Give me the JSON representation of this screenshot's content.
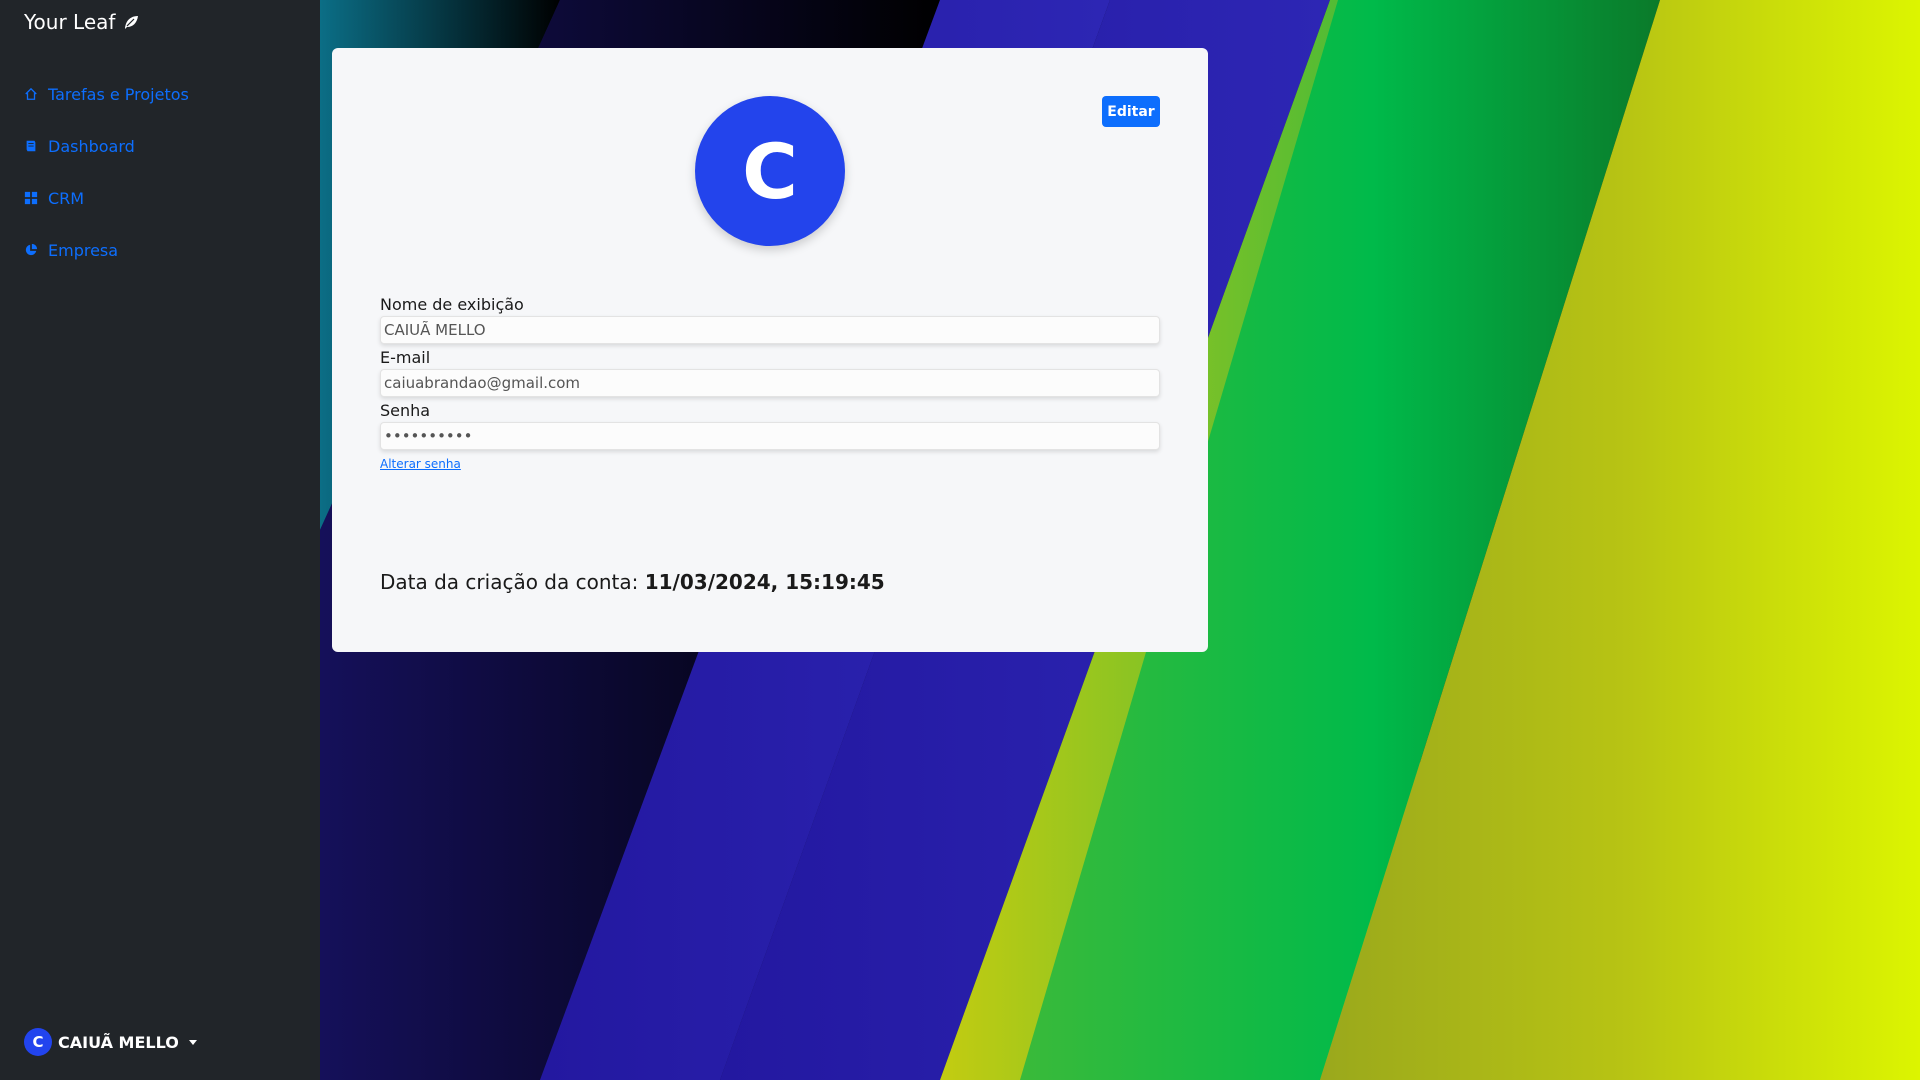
{
  "sidebar": {
    "brand": "Your Leaf",
    "brand_icon": "leaf-icon",
    "items": [
      {
        "label": "Tarefas e Projetos",
        "icon": "house-icon"
      },
      {
        "label": "Dashboard",
        "icon": "book-icon"
      },
      {
        "label": "CRM",
        "icon": "grid-icon"
      },
      {
        "label": "Empresa",
        "icon": "pie-chart-icon"
      }
    ],
    "user": {
      "initial": "C",
      "name": "CAIUÃ MELLO"
    }
  },
  "profile": {
    "avatar_initial": "C",
    "edit_label": "Editar",
    "fields": {
      "name_label": "Nome de exibição",
      "name_value": "CAIUÃ MELLO",
      "email_label": "E-mail",
      "email_value": "caiuabrandao@gmail.com",
      "password_label": "Senha",
      "password_value": "••••••••••"
    },
    "change_password_label": "Alterar senha",
    "created_label": "Data da criação da conta:",
    "created_value": "11/03/2024, 15:19:45"
  },
  "colors": {
    "sidebar_bg": "#212529",
    "link": "#0d6efd",
    "avatar": "#2344ec",
    "card_bg": "#f6f7f9"
  }
}
